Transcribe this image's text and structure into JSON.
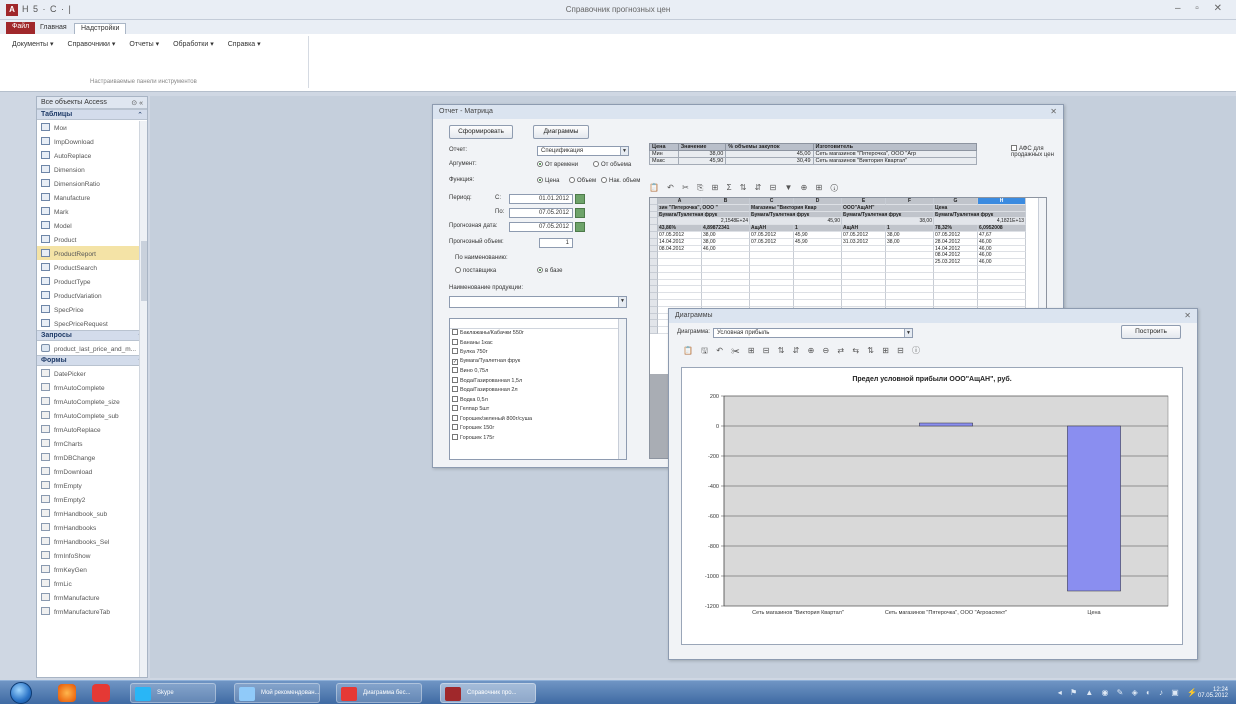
{
  "window": {
    "title": "Справочник прогнозных цен",
    "app_icon": "A",
    "qat": "H 5 · C · |"
  },
  "ribbon": {
    "tabs": [
      "Файл",
      "Главная",
      "Надстройки"
    ],
    "menus": [
      "Документы ▾",
      "Справочники ▾",
      "Отчеты ▾",
      "Обработки ▾",
      "Справка ▾"
    ],
    "group_label": "Настраиваемые панели инструментов"
  },
  "nav": {
    "header": "Все объекты Access",
    "groups": {
      "tables": "Таблицы",
      "queries": "Запросы",
      "forms": "Формы"
    },
    "tables": [
      "Мои",
      "ImpDownload",
      "AutoReplace",
      "Dimension",
      "DimensionRatio",
      "Manufacture",
      "Mark",
      "Model",
      "Product",
      "ProductReport",
      "ProductSearch",
      "ProductType",
      "ProductVariation",
      "SpecPrice",
      "SpecPriceRequest"
    ],
    "queries": [
      "product_last_price_and_m..."
    ],
    "forms": [
      "DatePicker",
      "frmAutoComplete",
      "frmAutoComplete_size",
      "frmAutoComplete_sub",
      "frmAutoReplace",
      "frmCharts",
      "frmDBChange",
      "frmDownload",
      "frmEmpty",
      "frmEmpty2",
      "frmHandbook_sub",
      "frmHandbooks",
      "frmHandbooks_Sel",
      "frmInfoShow",
      "frmKeyGen",
      "frmLic",
      "frmManufacture",
      "frmManufactureTab"
    ],
    "selected_table": "ProductReport"
  },
  "report": {
    "title": "Отчет - Матрица",
    "form_button": "Сформировать",
    "chart_button": "Диаграммы",
    "labels": {
      "report": "Отчет:",
      "argument": "Аргумент:",
      "function": "Функция:",
      "period": "Период:",
      "from": "С:",
      "to": "По:",
      "forecast_date": "Прогнозная дата:",
      "forecast_volume": "Прогнозный объем:",
      "by_name": "По наименованию:",
      "product_name": "Наименование продукции:",
      "agent": "АФС для продажных цен"
    },
    "report_value": "Спецификация",
    "argument_options": [
      "От времени",
      "От объема"
    ],
    "function_options": [
      "Цена",
      "Объем",
      "Нак. объем"
    ],
    "period_from": "01.01.2012",
    "period_to": "07.05.2012",
    "forecast_date": "07.05.2012",
    "forecast_volume": "1",
    "name_options": [
      "поставщика",
      "в базе"
    ],
    "products": [
      {
        "name": "Баклажаны/Кабачки 550г",
        "checked": false
      },
      {
        "name": "Бананы 1кас",
        "checked": false
      },
      {
        "name": "Булка 750г",
        "checked": false
      },
      {
        "name": "Бумага/Туалетная фрук",
        "checked": true
      },
      {
        "name": "Вино 0,75л",
        "checked": false
      },
      {
        "name": "Вода/Газированная 1,5л",
        "checked": false
      },
      {
        "name": "Вода/Газированная 2л",
        "checked": false
      },
      {
        "name": "Водка 0,5л",
        "checked": false
      },
      {
        "name": "Гелпар 5шт",
        "checked": false
      },
      {
        "name": "Горошек/зеленый 800г/суша",
        "checked": false
      },
      {
        "name": "Горошек 150г",
        "checked": false
      },
      {
        "name": "Горошек 175г",
        "checked": false
      }
    ],
    "summary": {
      "headers": [
        "Цена",
        "Значение",
        "% объемы закупок",
        "Изготовитель"
      ],
      "rows": [
        [
          "Мин",
          "38,00",
          "45,00",
          "Сеть магазинов \"Пятерочка\", ООО \"Агр"
        ],
        [
          "Макс",
          "45,90",
          "30,49",
          "Сеть магазинов \"Виктория Квартал\""
        ]
      ]
    },
    "toolbar": "📋 ↶ ✂ ⎘ ⊞ Σ ⇅ ⇵ ⊟ ▼ ⊕ ⊞ ⓘ",
    "pivot": {
      "col_groups": [
        "зин \"Пятерочка\", ООО \"",
        "Магазины \"Виктория Квар",
        "ООО\"АщАН\"",
        "Цена"
      ],
      "subheads": [
        "Бумага/Туалетная фрук",
        "Бумага/Туалетная фрук",
        "Бумага/Туалетная фрук",
        "Бумага/Туалетная фрук"
      ],
      "totals": [
        "2,1548E+24",
        "45,90",
        "38,00",
        "4,1821E+13"
      ],
      "shares": [
        "43,86%",
        "4,89872341",
        "АщАН",
        "1",
        "АщАН",
        "1",
        "78,32%",
        "6,0952008"
      ],
      "rows": [
        [
          "07.05.2012",
          "38,00",
          "07.05.2012",
          "45,90",
          "07.05.2012",
          "38,00",
          "07.05.2012",
          "47,67"
        ],
        [
          "14.04.2012",
          "38,00",
          "07.05.2012",
          "45,90",
          "31.03.2012",
          "38,00",
          "28.04.2012",
          "46,00"
        ],
        [
          "08.04.2012",
          "46,00",
          "",
          "",
          "",
          "",
          "14.04.2012",
          "46,00"
        ],
        [
          "",
          "",
          "",
          "",
          "",
          "",
          "08.04.2012",
          "46,00"
        ],
        [
          "",
          "",
          "",
          "",
          "",
          "",
          "25.03.2012",
          "46,00"
        ]
      ],
      "active_col": "H"
    }
  },
  "chart_window": {
    "title": "Диаграммы",
    "label": "Диаграмма:",
    "selected": "Условная прибыль",
    "build_button": "Построить",
    "toolbar": "📋 🖫 ↶ ✂ ⊞ ⊟ ⇅ ⇵ ⊕ ⊖ ⇄ ⇆ ⇅ ⊞ ⊟ ⓘ"
  },
  "chart_data": {
    "type": "bar",
    "title": "Предел условной прибыли ООО\"АщАН\", руб.",
    "categories": [
      "Сеть магазинов \"Виктория Квартал\"",
      "Сеть магазинов \"Пятерочка\", ООО \"Агроаспект\"",
      "Цена"
    ],
    "values": [
      0,
      20,
      -1100
    ],
    "ylim": [
      -1200,
      200
    ],
    "yticks": [
      "200",
      "0",
      "-200",
      "-400",
      "-600",
      "-800",
      "-1000",
      "-1200"
    ],
    "ytick_values": [
      200,
      0,
      -200,
      -400,
      -600,
      -800,
      -1000,
      -1200
    ],
    "bar_color": "#8a8ef0",
    "grid": true
  },
  "taskbar": {
    "tasks": [
      "Skype",
      "Мой рекомендован...",
      "Диаграмма бес...",
      "Справочник про..."
    ],
    "time": "12:24",
    "date": "07.05.2012"
  }
}
